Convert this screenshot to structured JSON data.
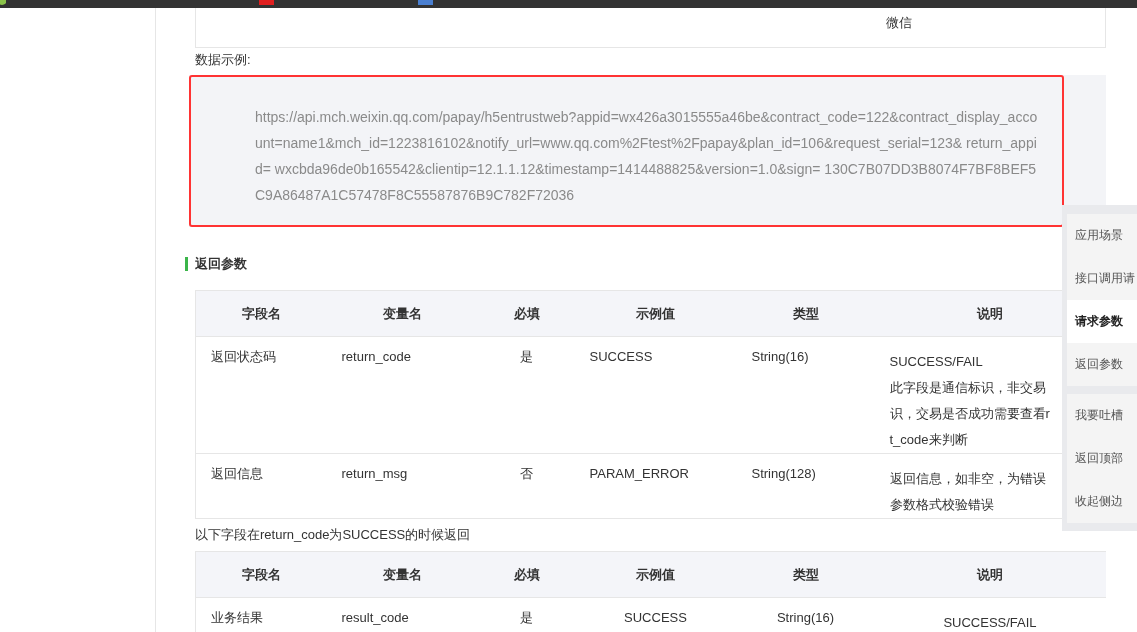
{
  "top_table": {
    "cell": "微信"
  },
  "example": {
    "label": "数据示例:",
    "url": "https://api.mch.weixin.qq.com/papay/h5entrustweb?appid=wx426a3015555a46be&contract_code=122&contract_display_account=name1&mch_id=1223816102&notify_url=www.qq.com%2Ftest%2Fpapay&plan_id=106&request_serial=123& return_appid= wxcbda96de0b165542&clientip=12.1.1.12&timestamp=1414488825&version=1.0&sign= 130C7B07DD3B8074F7BF8BEF5C9A86487A1C57478F8C55587876B9C782F72036"
  },
  "section_title": "返回参数",
  "tables": [
    {
      "columns": [
        "字段名",
        "变量名",
        "必填",
        "示例值",
        "类型",
        "说明"
      ],
      "rows": [
        {
          "cells": [
            "返回状态码",
            "return_code",
            "是",
            "SUCCESS",
            "String(16)"
          ],
          "description": [
            "SUCCESS/FAIL",
            "此字段是通信标识，非交易",
            "识，交易是否成功需要查看r",
            "t_code来判断"
          ]
        },
        {
          "cells": [
            "返回信息",
            "return_msg",
            "否",
            "PARAM_ERROR",
            "String(128)"
          ],
          "description": [
            "返回信息，如非空，为错误",
            "参数格式校验错误"
          ]
        }
      ]
    },
    {
      "note": "以下字段在return_code为SUCCESS的时候返回",
      "columns": [
        "字段名",
        "变量名",
        "必填",
        "示例值",
        "类型",
        "说明"
      ],
      "rows": [
        {
          "cells": [
            "业务结果",
            "result_code",
            "是",
            "SUCCESS",
            "String(16)"
          ],
          "description": [
            "SUCCESS/FAIL"
          ]
        }
      ]
    }
  ],
  "sidebar": {
    "groups": [
      {
        "items": [
          {
            "label": "应用场景",
            "selected": false
          },
          {
            "label": "接口调用请",
            "selected": false
          },
          {
            "label": "请求参数",
            "selected": true
          },
          {
            "label": "返回参数",
            "selected": false
          }
        ]
      },
      {
        "items": [
          {
            "label": "我要吐槽",
            "selected": false
          },
          {
            "label": "返回顶部",
            "selected": false
          },
          {
            "label": "收起侧边",
            "selected": false
          }
        ]
      }
    ]
  }
}
